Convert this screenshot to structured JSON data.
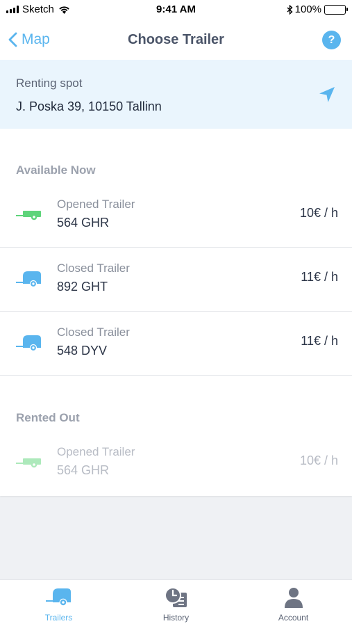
{
  "status_bar": {
    "carrier": "Sketch",
    "time": "9:41 AM",
    "battery": "100%"
  },
  "nav": {
    "back_label": "Map",
    "title": "Choose Trailer",
    "help_label": "?"
  },
  "renting_spot": {
    "label": "Renting spot",
    "address": "J. Poska 39, 10150 Tallinn"
  },
  "sections": {
    "available_title": "Available Now",
    "rented_title": "Rented Out"
  },
  "available": [
    {
      "type": "Opened Trailer",
      "plate": "564 GHR",
      "price": "10€ / h",
      "icon": "opened-trailer-icon"
    },
    {
      "type": "Closed Trailer",
      "plate": "892 GHT",
      "price": "11€ / h",
      "icon": "closed-trailer-icon"
    },
    {
      "type": "Closed Trailer",
      "plate": "548 DYV",
      "price": "11€ / h",
      "icon": "closed-trailer-icon"
    }
  ],
  "rented": [
    {
      "type": "Opened Trailer",
      "plate": "564 GHR",
      "price": "10€ / h",
      "icon": "opened-trailer-icon"
    }
  ],
  "tabs": [
    {
      "label": "Trailers",
      "icon": "trailer-tab-icon",
      "active": true
    },
    {
      "label": "History",
      "icon": "history-icon",
      "active": false
    },
    {
      "label": "Account",
      "icon": "account-icon",
      "active": false
    }
  ],
  "colors": {
    "accent": "#5ab5ee",
    "opened_trailer": "#5ed47a",
    "spot_background": "#eaf5fd"
  }
}
